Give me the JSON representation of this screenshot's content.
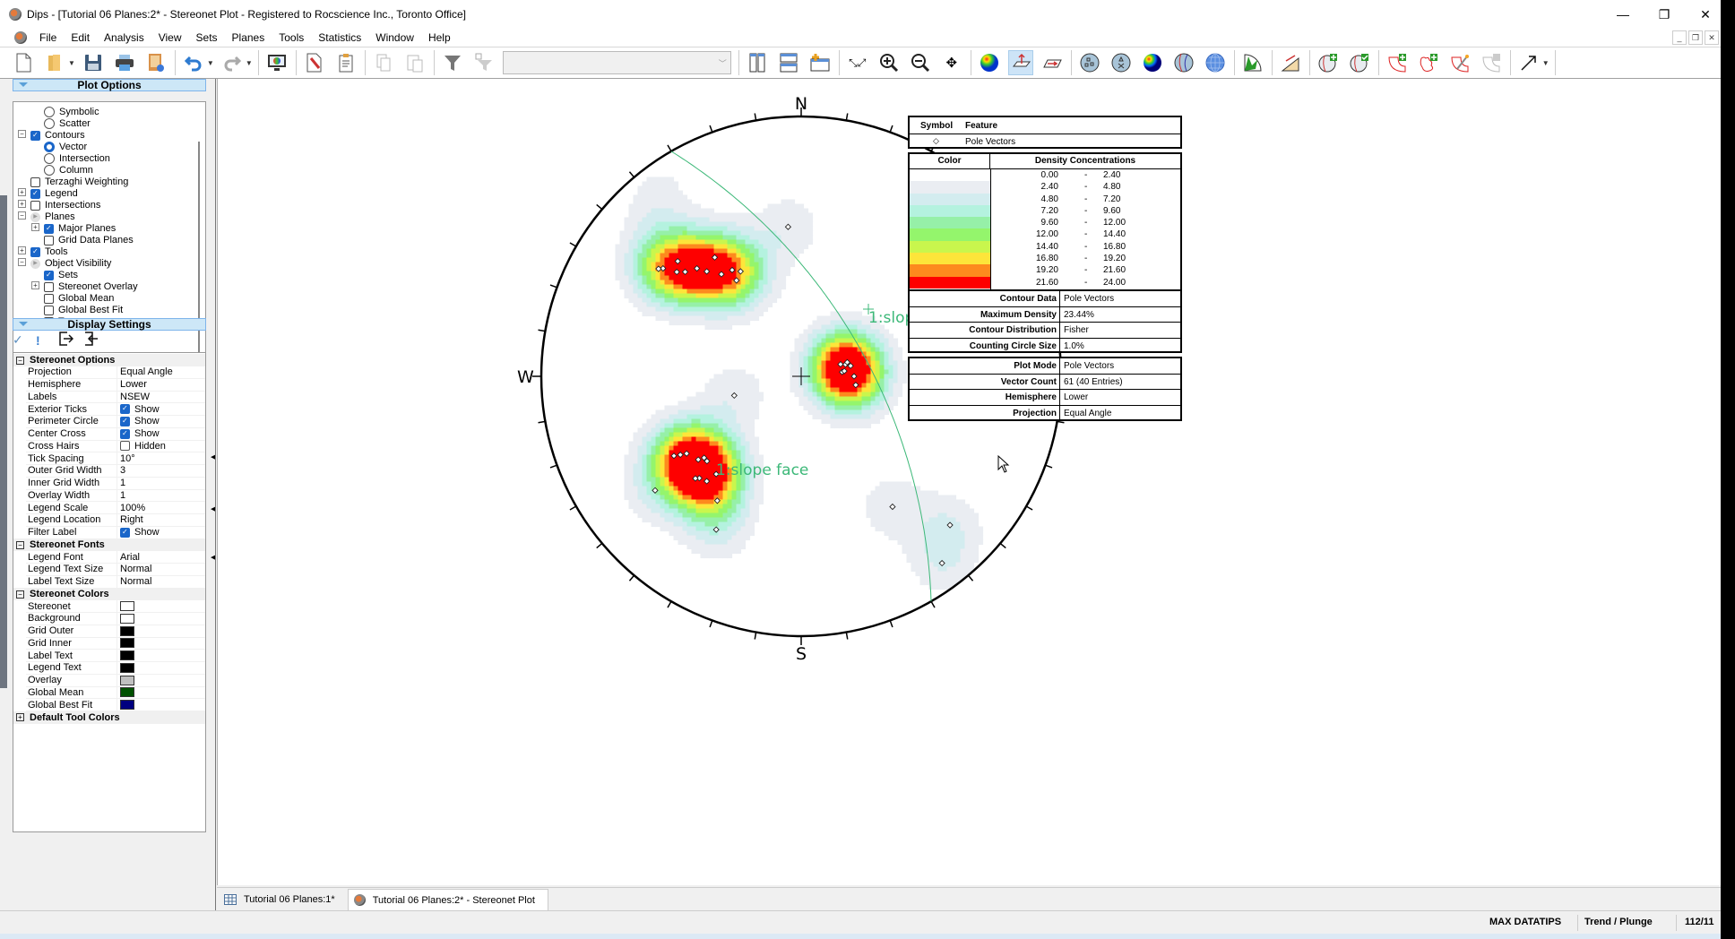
{
  "window": {
    "title": "Dips - [Tutorial 06 Planes:2* - Stereonet Plot - Registered to Rocscience Inc., Toronto Office]",
    "controls": [
      "minimize",
      "restore",
      "close"
    ]
  },
  "menubar": {
    "items": [
      "File",
      "Edit",
      "Analysis",
      "View",
      "Sets",
      "Planes",
      "Tools",
      "Statistics",
      "Window",
      "Help"
    ]
  },
  "toolbar": {
    "buttons": [
      {
        "name": "new-icon"
      },
      {
        "name": "open-icon"
      },
      {
        "name": "save-icon"
      },
      {
        "name": "print-icon"
      },
      {
        "name": "report-icon"
      },
      {
        "name": "undo-icon"
      },
      {
        "name": "redo-icon"
      },
      {
        "name": "display-options-icon"
      },
      {
        "name": "edit-icon"
      },
      {
        "name": "clipboard-icon"
      },
      {
        "name": "copy-icon"
      },
      {
        "name": "paste-icon"
      },
      {
        "name": "filter-icon"
      },
      {
        "name": "filter-list-icon"
      },
      {
        "name": "tile-vertical-icon"
      },
      {
        "name": "tile-horizontal-icon"
      },
      {
        "name": "new-window-icon"
      },
      {
        "name": "zoom-extents-icon"
      },
      {
        "name": "zoom-in-icon"
      },
      {
        "name": "zoom-out-icon"
      },
      {
        "name": "pan-icon"
      },
      {
        "name": "contour-plot-icon"
      },
      {
        "name": "pole-plot-icon"
      },
      {
        "name": "dip-vector-icon"
      },
      {
        "name": "scatter-plot-icon"
      },
      {
        "name": "symbolic-plot-icon"
      },
      {
        "name": "contour-sphere-icon"
      },
      {
        "name": "major-planes-icon"
      },
      {
        "name": "grid-icon"
      },
      {
        "name": "rosette-icon"
      },
      {
        "name": "kinematic-icon"
      },
      {
        "name": "add-plane-icon"
      },
      {
        "name": "edit-plane-icon"
      },
      {
        "name": "add-set-window-icon"
      },
      {
        "name": "add-curved-window-icon"
      },
      {
        "name": "auto-sets-icon"
      },
      {
        "name": "edit-set-icon"
      },
      {
        "name": "arrow-tool-icon"
      }
    ],
    "combo_value": ""
  },
  "plot_options": {
    "header": "Plot Options",
    "items": [
      {
        "label": "Symbolic",
        "type": "radio",
        "checked": false,
        "indent": 2
      },
      {
        "label": "Scatter",
        "type": "radio",
        "checked": false,
        "indent": 2
      },
      {
        "label": "Contours",
        "type": "check",
        "checked": true,
        "indent": 1,
        "expander": "-"
      },
      {
        "label": "Vector",
        "type": "radio",
        "checked": true,
        "indent": 2
      },
      {
        "label": "Intersection",
        "type": "radio",
        "checked": false,
        "indent": 2
      },
      {
        "label": "Column",
        "type": "radio",
        "checked": false,
        "indent": 2
      },
      {
        "label": "Terzaghi Weighting",
        "type": "check",
        "checked": false,
        "indent": 1
      },
      {
        "label": "Legend",
        "type": "check",
        "checked": true,
        "indent": 1,
        "expander": "+"
      },
      {
        "label": "Intersections",
        "type": "check",
        "checked": false,
        "indent": 1,
        "expander": "+"
      },
      {
        "label": "Planes",
        "type": "partial",
        "checked": false,
        "indent": 1,
        "expander": "-"
      },
      {
        "label": "Major Planes",
        "type": "check",
        "checked": true,
        "indent": 2,
        "expander": "+"
      },
      {
        "label": "Grid Data Planes",
        "type": "check",
        "checked": false,
        "indent": 2
      },
      {
        "label": "Tools",
        "type": "check",
        "checked": true,
        "indent": 1,
        "expander": "+"
      },
      {
        "label": "Object Visibility",
        "type": "partial",
        "checked": false,
        "indent": 1,
        "expander": "-"
      },
      {
        "label": "Sets",
        "type": "check",
        "checked": true,
        "indent": 2
      },
      {
        "label": "Stereonet Overlay",
        "type": "check",
        "checked": false,
        "indent": 2,
        "expander": "+"
      },
      {
        "label": "Global Mean",
        "type": "check",
        "checked": false,
        "indent": 2
      },
      {
        "label": "Global Best Fit",
        "type": "check",
        "checked": false,
        "indent": 2
      },
      {
        "label": "Traverses",
        "type": "check",
        "checked": false,
        "indent": 2
      }
    ]
  },
  "display_settings": {
    "header": "Display Settings",
    "tool_icons": [
      "apply-check-icon",
      "warning-icon",
      "export-icon",
      "import-icon"
    ],
    "categories": [
      {
        "label": "Stereonet Options",
        "expanded": true,
        "rows": [
          {
            "key": "Projection",
            "value": "Equal Angle"
          },
          {
            "key": "Hemisphere",
            "value": "Lower"
          },
          {
            "key": "Labels",
            "value": "NSEW"
          },
          {
            "key": "Exterior Ticks",
            "value": "Show",
            "checkbox": true
          },
          {
            "key": "Perimeter Circle",
            "value": "Show",
            "checkbox": true
          },
          {
            "key": "Center Cross",
            "value": "Show",
            "checkbox": true
          },
          {
            "key": "Cross Hairs",
            "value": "Hidden",
            "checkbox": false
          },
          {
            "key": "Tick Spacing",
            "value": "10°"
          },
          {
            "key": "Outer Grid Width",
            "value": "3"
          },
          {
            "key": "Inner Grid Width",
            "value": "1"
          },
          {
            "key": "Overlay Width",
            "value": "1"
          },
          {
            "key": "Legend Scale",
            "value": "100%"
          },
          {
            "key": "Legend Location",
            "value": "Right"
          },
          {
            "key": "Filter Label",
            "value": "Show",
            "checkbox": true
          }
        ]
      },
      {
        "label": "Stereonet Fonts",
        "expanded": true,
        "rows": [
          {
            "key": "Legend Font",
            "value": "Arial"
          },
          {
            "key": "Legend Text Size",
            "value": "Normal"
          },
          {
            "key": "Label Text Size",
            "value": "Normal"
          }
        ]
      },
      {
        "label": "Stereonet Colors",
        "expanded": true,
        "rows": [
          {
            "key": "Stereonet",
            "color": "#ffffff"
          },
          {
            "key": "Background",
            "color": "#ffffff"
          },
          {
            "key": "Grid Outer",
            "color": "#000000"
          },
          {
            "key": "Grid Inner",
            "color": "#000000"
          },
          {
            "key": "Label Text",
            "color": "#000000"
          },
          {
            "key": "Legend Text",
            "color": "#000000"
          },
          {
            "key": "Overlay",
            "color": "#c0c0c0"
          },
          {
            "key": "Global Mean",
            "color": "#005000"
          },
          {
            "key": "Global Best Fit",
            "color": "#000080"
          }
        ]
      },
      {
        "label": "Default Tool Colors",
        "expanded": false,
        "rows": []
      }
    ]
  },
  "stereonet": {
    "labels": {
      "n": "N",
      "s": "S",
      "e": "E",
      "w": "W"
    },
    "tick_spacing_deg": 10,
    "plane_label": "1:slope face",
    "plane": {
      "dip_direction": 60,
      "dip": 62,
      "color": "#3cb878"
    },
    "pole_vectors_approx_trend_plunge": [
      [
        322,
        37
      ],
      [
        326,
        42
      ],
      [
        327,
        38
      ],
      [
        330,
        40
      ],
      [
        324,
        31
      ],
      [
        318,
        33
      ],
      [
        313,
        24
      ],
      [
        312,
        28
      ],
      [
        310,
        26
      ],
      [
        308,
        22
      ],
      [
        307,
        21
      ],
      [
        316,
        30
      ],
      [
        355,
        30
      ],
      [
        238,
        30
      ],
      [
        236,
        34
      ],
      [
        237,
        32
      ],
      [
        231,
        36
      ],
      [
        230,
        38
      ],
      [
        225,
        32
      ],
      [
        222,
        33
      ],
      [
        221,
        37
      ],
      [
        228,
        38
      ],
      [
        226,
        31
      ],
      [
        214,
        30
      ],
      [
        209,
        22
      ],
      [
        232,
        19
      ],
      [
        73,
        72
      ],
      [
        75,
        70
      ],
      [
        73,
        69
      ],
      [
        78,
        68
      ],
      [
        84,
        72
      ],
      [
        83,
        71
      ],
      [
        90,
        67
      ],
      [
        99,
        66
      ],
      [
        254,
        60
      ],
      [
        135,
        12
      ],
      [
        143,
        6
      ],
      [
        145,
        27
      ]
    ]
  },
  "legend": {
    "symbol_header": "Symbol",
    "feature_header": "Feature",
    "feature_symbol": "◇",
    "feature_label": "Pole Vectors",
    "color_header": "Color",
    "density_header": "Density Concentrations",
    "bins": [
      {
        "from": "0.00",
        "to": "2.40",
        "color": "#ffffff"
      },
      {
        "from": "2.40",
        "to": "4.80",
        "color": "#eaedf2"
      },
      {
        "from": "4.80",
        "to": "7.20",
        "color": "#d3ecef"
      },
      {
        "from": "7.20",
        "to": "9.60",
        "color": "#b4f2df"
      },
      {
        "from": "9.60",
        "to": "12.00",
        "color": "#96f0a8"
      },
      {
        "from": "12.00",
        "to": "14.40",
        "color": "#94f56c"
      },
      {
        "from": "14.40",
        "to": "16.80",
        "color": "#c9f64d"
      },
      {
        "from": "16.80",
        "to": "19.20",
        "color": "#fde53a"
      },
      {
        "from": "19.20",
        "to": "21.60",
        "color": "#fd8a1e"
      },
      {
        "from": "21.60",
        "to": "24.00",
        "color": "#fe0000"
      }
    ],
    "contour_info": [
      {
        "key": "Contour Data",
        "value": "Pole Vectors"
      },
      {
        "key": "Maximum Density",
        "value": "23.44%"
      },
      {
        "key": "Contour Distribution",
        "value": "Fisher"
      },
      {
        "key": "Counting Circle Size",
        "value": "1.0%"
      }
    ],
    "plot_info": [
      {
        "key": "Plot Mode",
        "value": "Pole Vectors"
      },
      {
        "key": "Vector Count",
        "value": "61 (40 Entries)"
      },
      {
        "key": "Hemisphere",
        "value": "Lower"
      },
      {
        "key": "Projection",
        "value": "Equal Angle"
      }
    ]
  },
  "doc_tabs": [
    {
      "label": "Tutorial 06 Planes:1*",
      "icon": "table-icon",
      "active": false
    },
    {
      "label": "Tutorial 06 Planes:2* - Stereonet Plot",
      "icon": "stereonet-icon",
      "active": true
    }
  ],
  "statusbar": {
    "max_datatips": "MAX DATATIPS",
    "mode": "Trend / Plunge",
    "value": "112/11"
  }
}
